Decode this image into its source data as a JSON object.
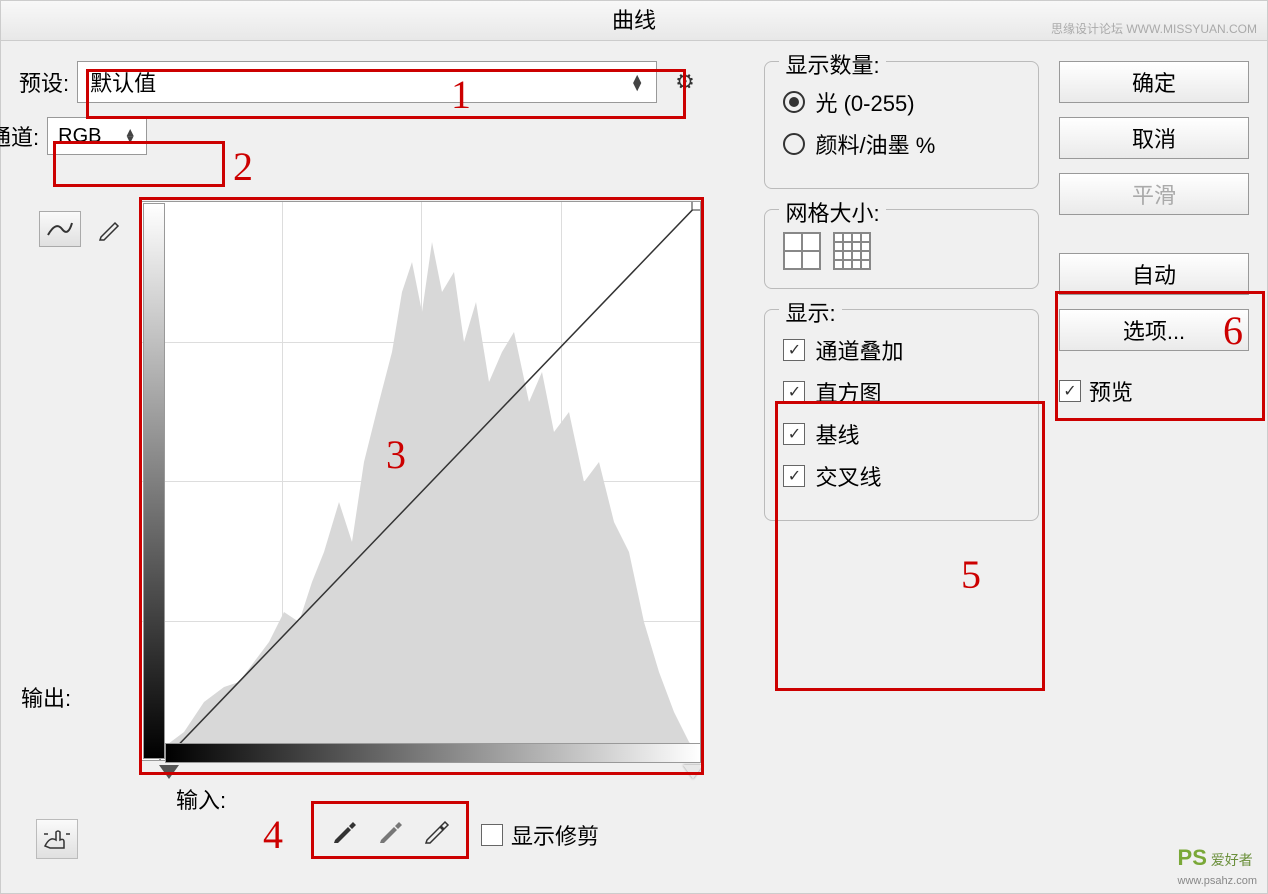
{
  "title": "曲线",
  "watermark_top": "思缘设计论坛 WWW.MISSYUAN.COM",
  "preset": {
    "label": "预设:",
    "value": "默认值"
  },
  "channel": {
    "label": "通道:",
    "value": "RGB"
  },
  "output_label": "输出:",
  "input_label": "输入:",
  "show_clip": "显示修剪",
  "display_amount": {
    "title": "显示数量:",
    "opt_light": "光 (0-255)",
    "opt_pigment": "颜料/油墨 %"
  },
  "grid_size": {
    "title": "网格大小:"
  },
  "show": {
    "title": "显示:",
    "channel_overlay": "通道叠加",
    "histogram": "直方图",
    "baseline": "基线",
    "intersection": "交叉线"
  },
  "buttons": {
    "ok": "确定",
    "cancel": "取消",
    "smooth": "平滑",
    "auto": "自动",
    "options": "选项..."
  },
  "preview": "预览",
  "annotations": {
    "n1": "1",
    "n2": "2",
    "n3": "3",
    "n4": "4",
    "n5": "5",
    "n6": "6"
  },
  "watermark_bottom": {
    "logo": "PS",
    "name": "爱好者",
    "url": "www.psahz.com"
  },
  "chart_data": {
    "type": "line",
    "title": "曲线",
    "xlabel": "输入",
    "ylabel": "输出",
    "xlim": [
      0,
      255
    ],
    "ylim": [
      0,
      255
    ],
    "series": [
      {
        "name": "RGB曲线",
        "x": [
          0,
          255
        ],
        "y": [
          0,
          255
        ]
      }
    ],
    "histogram_shape": "山形直方图，中间调区域最高，暗部和高光较低"
  }
}
